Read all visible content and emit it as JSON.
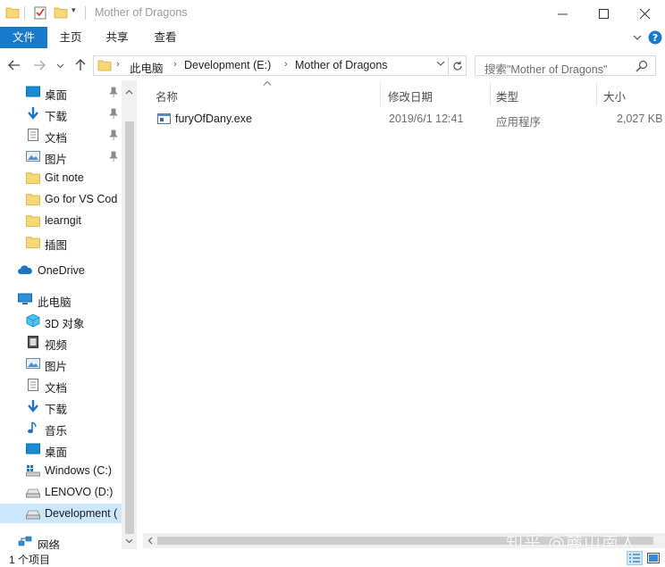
{
  "window": {
    "title": "Mother of Dragons",
    "controls": {
      "minimize": "—",
      "maximize": "☐",
      "close": "✕"
    }
  },
  "ribbon": {
    "tabs": [
      {
        "label": "文件",
        "active": true
      },
      {
        "label": "主页"
      },
      {
        "label": "共享"
      },
      {
        "label": "查看"
      }
    ]
  },
  "address": {
    "crumbs": [
      "此电脑",
      "Development (E:)",
      "Mother of Dragons"
    ],
    "search_placeholder": "搜索\"Mother of Dragons\""
  },
  "nav": {
    "quick_access": [
      {
        "label": "桌面",
        "icon": "desktop-icon",
        "pinned": true
      },
      {
        "label": "下载",
        "icon": "download-icon",
        "pinned": true
      },
      {
        "label": "文档",
        "icon": "document-icon",
        "pinned": true
      },
      {
        "label": "图片",
        "icon": "pictures-icon",
        "pinned": true
      },
      {
        "label": "Git note",
        "icon": "folder-icon"
      },
      {
        "label": "Go for VS Cod",
        "icon": "folder-icon"
      },
      {
        "label": "learngit",
        "icon": "folder-icon"
      },
      {
        "label": "插图",
        "icon": "folder-icon"
      }
    ],
    "onedrive": "OneDrive",
    "this_pc": "此电脑",
    "pc_items": [
      {
        "label": "3D 对象",
        "icon": "3d-objects-icon"
      },
      {
        "label": "视频",
        "icon": "videos-icon"
      },
      {
        "label": "图片",
        "icon": "pictures-icon"
      },
      {
        "label": "文档",
        "icon": "document-icon"
      },
      {
        "label": "下载",
        "icon": "download-icon"
      },
      {
        "label": "音乐",
        "icon": "music-icon"
      },
      {
        "label": "桌面",
        "icon": "desktop-icon"
      },
      {
        "label": "Windows (C:)",
        "icon": "windows-drive-icon"
      },
      {
        "label": "LENOVO (D:)",
        "icon": "drive-icon"
      },
      {
        "label": "Development (",
        "icon": "drive-icon",
        "selected": true
      }
    ],
    "network": "网络"
  },
  "columns": {
    "name": "名称",
    "modified": "修改日期",
    "type": "类型",
    "size": "大小"
  },
  "files": [
    {
      "name": "furyOfDany.exe",
      "modified": "2019/6/1 12:41",
      "type": "应用程序",
      "size": "2,027 KB"
    }
  ],
  "status": {
    "count": "1 个项目"
  },
  "watermark": "知乎 @麓山南人",
  "colors": {
    "accent": "#1979ca",
    "selection": "#cce8ff",
    "folder": "#f8d775"
  }
}
